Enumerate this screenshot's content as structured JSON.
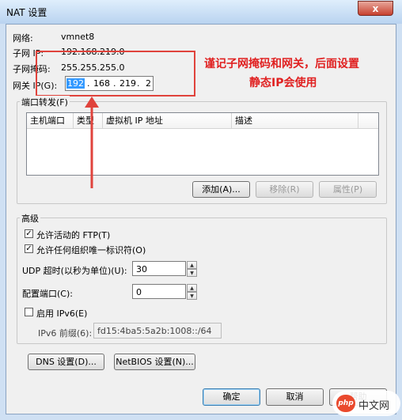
{
  "window": {
    "title": "NAT 设置",
    "close_glyph": "x"
  },
  "network": {
    "name_label": "网络:",
    "name_value": "vmnet8",
    "subnet_ip_label": "子网 IP:",
    "subnet_ip_value": "192.168.219.0",
    "subnet_mask_label": "子网掩码:",
    "subnet_mask_value": "255.255.255.0",
    "gateway_label": "网关 IP(G):",
    "gateway_parts": [
      "192",
      "168",
      "219",
      "2"
    ],
    "gateway_dots": [
      ".",
      ".",
      "."
    ]
  },
  "annotation": {
    "line1": "谨记子网掩码和网关，后面设置",
    "line2": "静态IP会使用",
    "color": "#e0433c"
  },
  "port_forwarding": {
    "title": "端口转发(F)",
    "columns": [
      "主机端口",
      "类型",
      "虚拟机 IP 地址",
      "描述"
    ],
    "add_label": "添加(A)...",
    "remove_label": "移除(R)",
    "properties_label": "属性(P)"
  },
  "advanced": {
    "title": "高级",
    "allow_ftp_label": "允许活动的 FTP(T)",
    "allow_ftp_checked": true,
    "allow_ouid_label": "允许任何组织唯一标识符(O)",
    "allow_ouid_checked": true,
    "udp_timeout_label": "UDP 超时(以秒为单位)(U):",
    "udp_timeout_value": "30",
    "config_port_label": "配置端口(C):",
    "config_port_value": "0",
    "enable_ipv6_label": "启用 IPv6(E)",
    "enable_ipv6_checked": false,
    "ipv6_prefix_label": "IPv6 前缀(6):",
    "ipv6_prefix_value": "fd15:4ba5:5a2b:1008::/64",
    "check_glyph": "✓",
    "spin_up": "▲",
    "spin_down": "▼"
  },
  "buttons": {
    "dns": "DNS 设置(D)...",
    "netbios": "NetBIOS 设置(N)...",
    "ok": "确定",
    "cancel": "取消",
    "help": "帮助"
  },
  "watermark": {
    "logo_text": "php",
    "site_text": "中文网"
  }
}
